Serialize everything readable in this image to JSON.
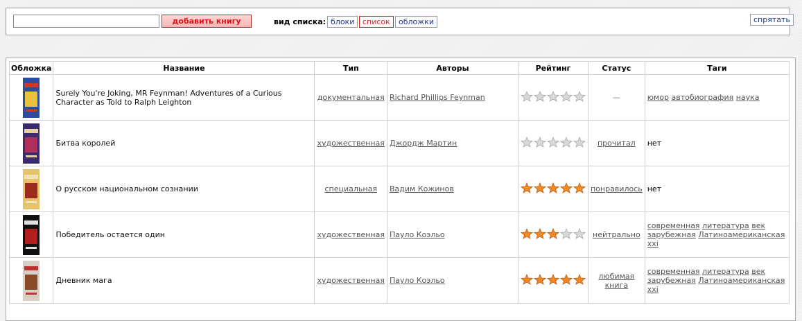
{
  "toolbar": {
    "search_value": "",
    "add_button": "добавить книгу",
    "view_label": "вид списка:",
    "view_options": [
      "блоки",
      "список",
      "обложки"
    ],
    "active_view": "список",
    "hide_button": "спрятать"
  },
  "table": {
    "headers": [
      "Обложка",
      "Название",
      "Тип",
      "Авторы",
      "Рейтинг",
      "Статус",
      "Таги"
    ],
    "rows": [
      {
        "title": "Surely You're Joking, MR Feynman! Adventures of a Curious Character as Told to Ralph Leighton",
        "type": "документальная",
        "author": "Richard Phillips Feynman",
        "rating": 0,
        "status": "—",
        "tags": [
          "юмор",
          "автобиография",
          "наука"
        ],
        "cover_colors": [
          "#2d4d9c",
          "#e8c23a",
          "#c83a2a"
        ]
      },
      {
        "title": "Битва королей",
        "type": "художественная",
        "author": "Джордж Мартин",
        "rating": 0,
        "status": "прочитал",
        "tags": [
          "нет"
        ],
        "cover_colors": [
          "#3b2a6e",
          "#b0305a",
          "#e8d3a0"
        ]
      },
      {
        "title": "О русском национальном сознании",
        "type": "специальная",
        "author": "Вадим Кожинов",
        "rating": 5,
        "status": "понравилось",
        "tags": [
          "нет"
        ],
        "cover_colors": [
          "#e6c36a",
          "#9a2c1c",
          "#f2e3b5"
        ]
      },
      {
        "title": "Победитель остается один",
        "type": "художественная",
        "author": "Пауло Коэльо",
        "rating": 3,
        "status": "нейтрально",
        "tags": [
          "современная",
          "литература",
          "век",
          "зарубежная",
          "Латиноамериканская",
          "xxi"
        ],
        "cover_colors": [
          "#111111",
          "#b31d1d",
          "#e0e0e0"
        ]
      },
      {
        "title": "Дневник мага",
        "type": "художественная",
        "author": "Пауло Коэльо",
        "rating": 5,
        "status": "любимая книга",
        "tags": [
          "современная",
          "литература",
          "век",
          "зарубежная",
          "Латиноамериканская",
          "xxi"
        ],
        "cover_colors": [
          "#d8d0c4",
          "#8a4a2a",
          "#b33"
        ]
      }
    ]
  }
}
